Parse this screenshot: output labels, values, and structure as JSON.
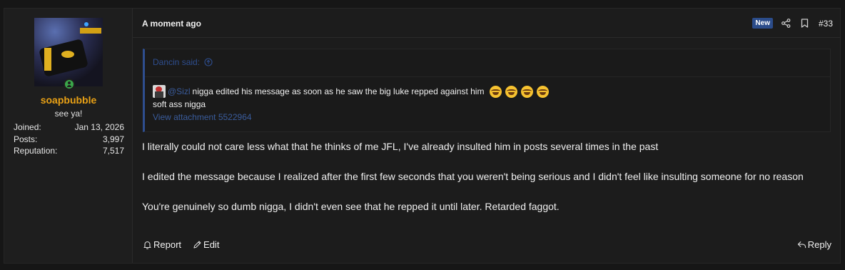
{
  "user": {
    "username": "soapbubble",
    "title": "see ya!",
    "stats": [
      {
        "label": "Joined:",
        "value": "Jan 13, 2026"
      },
      {
        "label": "Posts:",
        "value": "3,997"
      },
      {
        "label": "Reputation:",
        "value": "7,517"
      }
    ]
  },
  "post": {
    "time": "A moment ago",
    "badge": "New",
    "number": "#33",
    "quote": {
      "author": "Dancin said:",
      "mention": "@Sizl",
      "line1": "nigga edited his message as soon as he saw the big luke repped against him",
      "line2": "soft ass nigga",
      "attachment": "View attachment 5522964"
    },
    "message": [
      "I literally could not care less what that he thinks of me JFL, I've already insulted him in posts several times in the past",
      "I edited the message because I realized after the first few seconds that you weren't being serious and I didn't feel like insulting someone for no reason",
      "You're genuinely so dumb nigga, I didn't even see that he repped it until later. Retarded faggot."
    ],
    "actions": {
      "report": "Report",
      "edit": "Edit",
      "reply": "Reply"
    }
  },
  "icons": [
    "user-online-icon",
    "share-icon",
    "bookmark-icon",
    "arrow-up-circle-icon",
    "report-bell-icon",
    "edit-pencil-icon",
    "reply-icon",
    "laughing-emoji-icon"
  ],
  "colors": {
    "username": "#e9a115",
    "accent": "#2e4e8f",
    "badge": "#2b4c8a",
    "online": "#3aa64a"
  }
}
